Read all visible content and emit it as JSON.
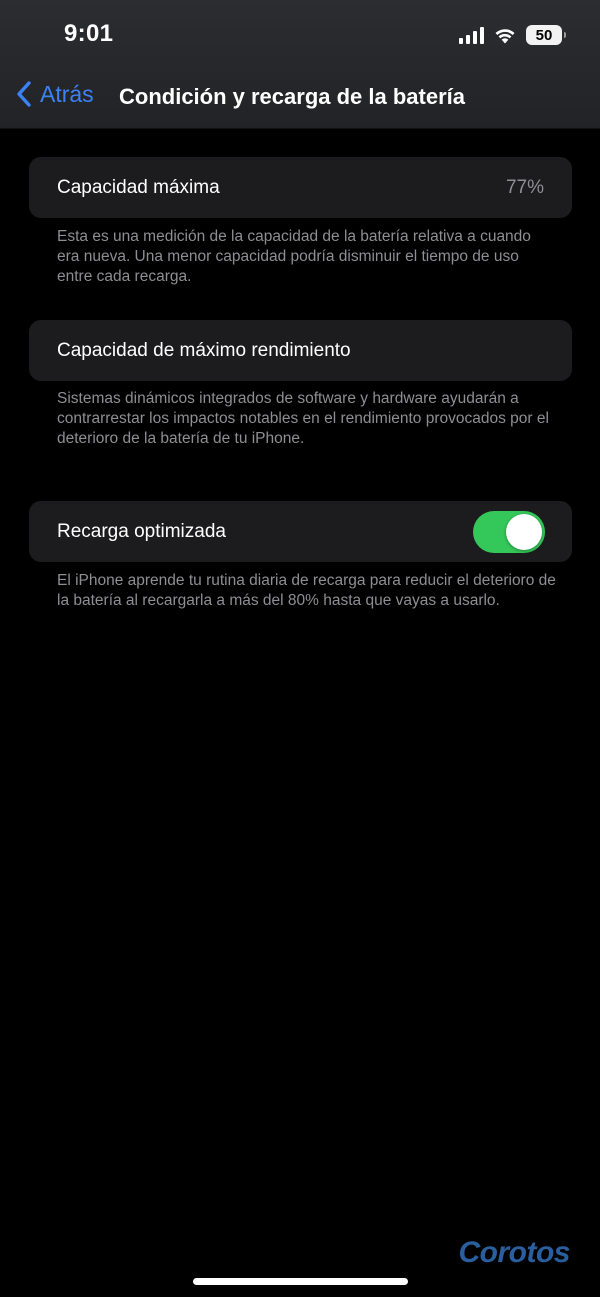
{
  "status_bar": {
    "time": "9:01",
    "battery_level": "50",
    "icons": [
      "cellular-signal-icon",
      "wifi-icon",
      "battery-icon"
    ]
  },
  "nav": {
    "back_label": "Atrás",
    "title": "Condición y recarga de la batería"
  },
  "sections": {
    "max_capacity": {
      "label": "Capacidad máxima",
      "value": "77%",
      "footnote": "Esta es una medición de la capacidad de la batería relativa a cuando era nueva. Una menor capacidad podría disminuir el tiempo de uso entre cada recarga."
    },
    "peak_performance": {
      "label": "Capacidad de máximo rendimiento",
      "footnote": "Sistemas dinámicos integrados de software y hardware ayudarán a contrarrestar los impactos notables en el rendimiento provocados por el deterioro de la batería de tu iPhone."
    },
    "optimized_charging": {
      "label": "Recarga optimizada",
      "enabled": true,
      "footnote": "El iPhone aprende tu rutina diaria de recarga para reducir el deterioro de la batería al recargarla a más del 80% hasta que vayas a usarlo."
    }
  },
  "watermark": "Corotos",
  "colors": {
    "accent": "#3b82f6",
    "toggle_on": "#34c759",
    "cell_background": "#1c1c1e",
    "secondary_text": "#8e8e93",
    "watermark": "#2c64a8"
  }
}
